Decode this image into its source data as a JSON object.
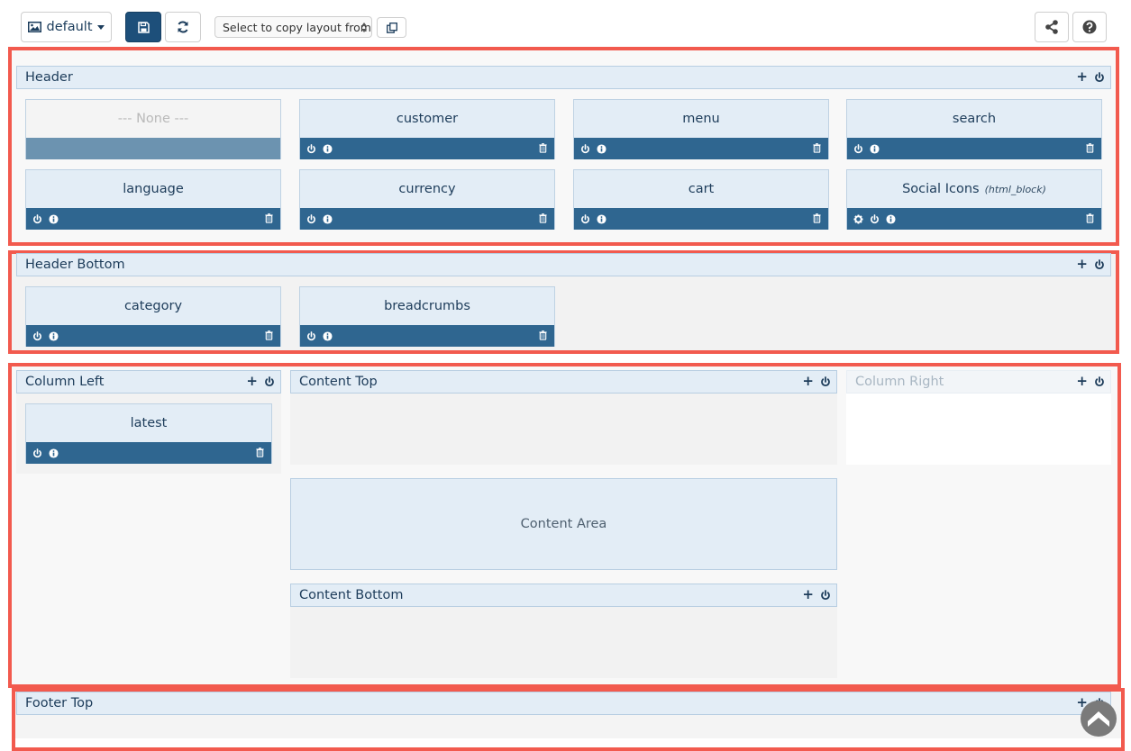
{
  "toolbar": {
    "layout_label": "default",
    "copy_placeholder": "Select to copy layout from"
  },
  "icons": {
    "image": "image-icon",
    "caret": "caret-down-icon",
    "save": "floppy-disk-icon",
    "refresh": "refresh-icon",
    "copy": "copy-icon",
    "share": "share-icon",
    "help": "question-icon",
    "add": "plus-icon",
    "power": "power-icon",
    "info": "info-icon",
    "trash": "trash-icon",
    "settings": "gear-icon",
    "scroll": "chevron-up-icon"
  },
  "colors": {
    "accent": "#1d4f7a",
    "frame": "#f25a4e",
    "module_footer": "#2f6690",
    "position_bg": "#e3edf6"
  },
  "positions": {
    "header": {
      "label": "Header",
      "modules": [
        {
          "name": "--- None ---"
        },
        {
          "name": "customer"
        },
        {
          "name": "menu"
        },
        {
          "name": "search"
        },
        {
          "name": "language"
        },
        {
          "name": "currency"
        },
        {
          "name": "cart"
        },
        {
          "name": "Social Icons",
          "type": "(html_block)"
        }
      ]
    },
    "header_bottom": {
      "label": "Header Bottom",
      "modules": [
        {
          "name": "category"
        },
        {
          "name": "breadcrumbs"
        }
      ]
    },
    "column_left": {
      "label": "Column Left",
      "modules": [
        {
          "name": "latest"
        }
      ]
    },
    "content_top": {
      "label": "Content Top"
    },
    "column_right": {
      "label": "Column Right"
    },
    "content_area": {
      "label": "Content Area"
    },
    "content_bottom": {
      "label": "Content Bottom"
    },
    "footer_top": {
      "label": "Footer Top"
    }
  }
}
